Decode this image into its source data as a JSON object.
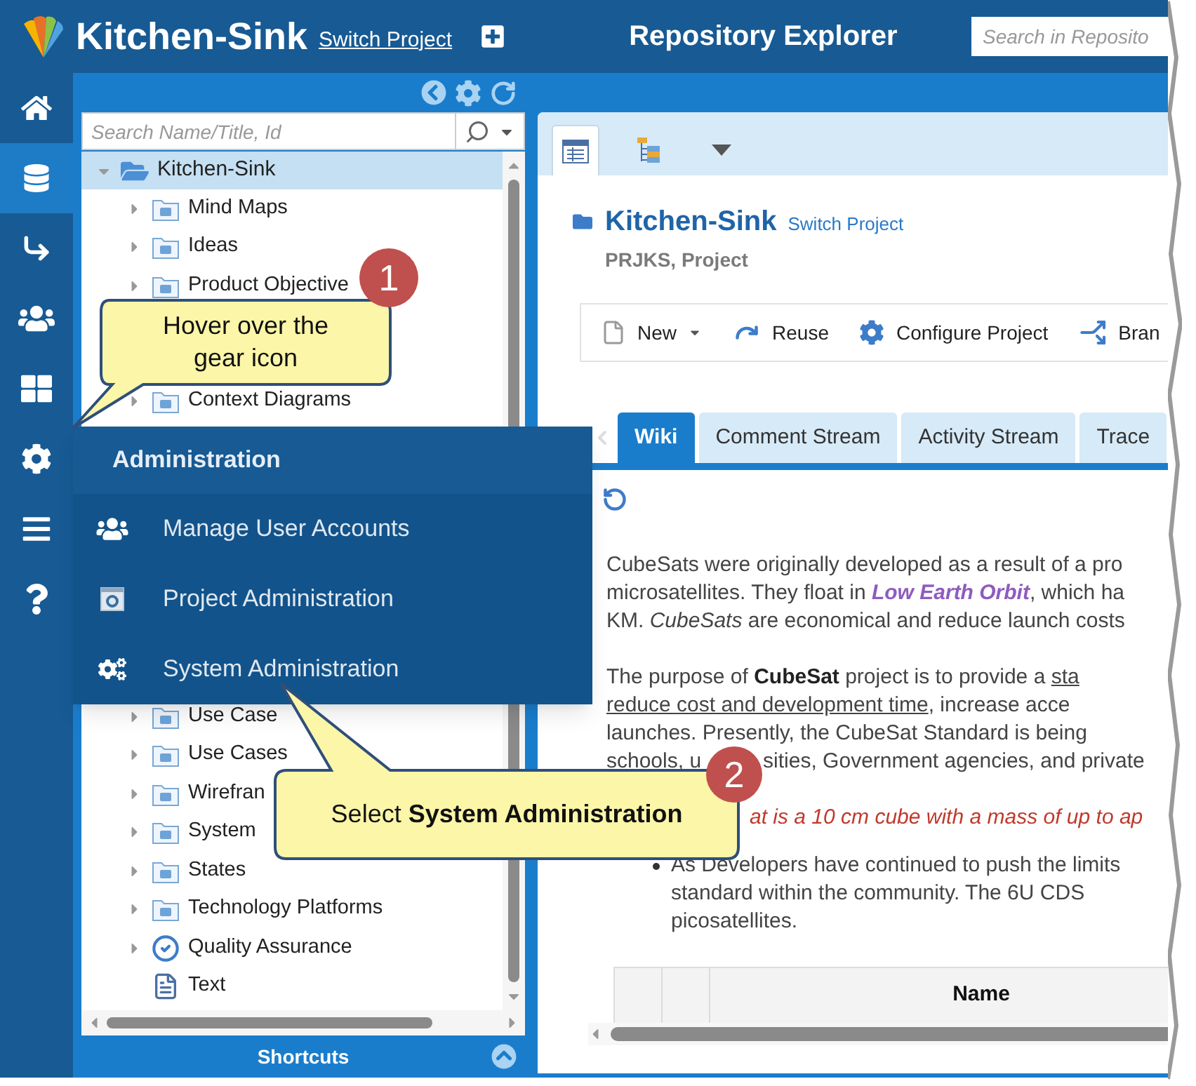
{
  "header": {
    "title": "Kitchen-Sink",
    "switch_link": "Switch Project",
    "page_title": "Repository Explorer",
    "search": {
      "placeholder": "Search in Reposito"
    }
  },
  "rail": [
    {
      "kind": "home",
      "selected": false
    },
    {
      "kind": "database",
      "selected": true
    },
    {
      "kind": "arrow",
      "selected": false
    },
    {
      "kind": "users",
      "selected": false
    },
    {
      "kind": "grid",
      "selected": false
    },
    {
      "kind": "settings",
      "selected": false
    },
    {
      "kind": "menu",
      "selected": false
    },
    {
      "kind": "help",
      "selected": false
    }
  ],
  "tree_panel": {
    "search": {
      "placeholder": "Search Name/Title, Id"
    },
    "tree": [
      {
        "label": "Kitchen-Sink",
        "expanded": true,
        "selected": true,
        "children": [
          {
            "label": "Mind Maps",
            "kind": "folder",
            "selected": false
          },
          {
            "label": "Ideas",
            "kind": "folder",
            "selected": false
          },
          {
            "label": "Product Objective",
            "kind": "folder",
            "selected": false
          },
          {
            "label": "Context Diagrams",
            "kind": "folder",
            "selected": false
          },
          {
            "label": "Use Case",
            "kind": "folder",
            "selected": false
          },
          {
            "label": "Use Cases",
            "kind": "folder",
            "selected": false
          },
          {
            "label": "Wirefran",
            "kind": "folder",
            "selected": false
          },
          {
            "label": "System",
            "kind": "folder",
            "selected": false
          },
          {
            "label": "States",
            "kind": "folder",
            "selected": false
          },
          {
            "label": "Technology Platforms",
            "kind": "folder",
            "selected": false
          },
          {
            "label": "Quality Assurance",
            "kind": "check",
            "selected": false
          },
          {
            "label": "Text",
            "kind": "document",
            "selected": false
          }
        ]
      }
    ],
    "footer": "Shortcuts"
  },
  "content": {
    "view_tabs": [
      {
        "kind": "grid",
        "selected": true
      },
      {
        "kind": "tree",
        "selected": false
      },
      {
        "kind": "menu",
        "selected": false
      }
    ],
    "project": {
      "title": "Kitchen-Sink",
      "link": "Switch Project",
      "subtitle": "PRJKS, Project"
    },
    "toolbar": [
      {
        "label": "New",
        "kind": "new"
      },
      {
        "label": "Reuse",
        "kind": "reuse"
      },
      {
        "label": "Configure Project",
        "kind": "configure"
      },
      {
        "label": "Bran",
        "kind": "branch"
      }
    ],
    "tabs": [
      {
        "label": "Wiki",
        "selected": true
      },
      {
        "label": "Comment Stream",
        "selected": false
      },
      {
        "label": "Activity Stream",
        "selected": false
      },
      {
        "label": "Trace",
        "selected": false
      }
    ],
    "wiki": {
      "paragraphs": [
        [
          [
            {
              "text": "CubeSats were originally developed as a result of a pro"
            }
          ],
          [
            {
              "text": "microsatellites. They float in "
            },
            {
              "text": "Low Earth Orbit",
              "kind": "link"
            },
            {
              "text": ", which ha"
            }
          ],
          [
            {
              "text": "KM. "
            },
            {
              "text": "CubeSats",
              "kind": "italic"
            },
            {
              "text": " are economical and reduce launch costs"
            }
          ]
        ],
        [
          [
            {
              "text": "The purpose of "
            },
            {
              "text": "CubeSat",
              "kind": "bold"
            },
            {
              "text": " project is to provide a "
            },
            {
              "text": "sta",
              "kind": "underline"
            }
          ],
          [
            {
              "text": "reduce cost and development time",
              "kind": "underline"
            },
            {
              "text": ", increase acce"
            }
          ],
          [
            {
              "text": "launches. Presently, the CubeSat Standard is being"
            }
          ],
          [
            {
              "text": "schools, u"
            },
            {
              "text": "sities, Government agencies, and private",
              "kind": "gap"
            }
          ]
        ]
      ],
      "highlight": "at is a 10 cm cube with a mass of up to ap",
      "bullet": [
        "As Developers have continued to push the limits",
        "standard within the community. The 6U CDS",
        "picosatellites."
      ],
      "table": {
        "columns": [
          {
            "label": "Name"
          }
        ]
      }
    }
  },
  "admin_menu": {
    "title": "Administration",
    "items": [
      {
        "label": "Manage User Accounts",
        "kind": "users"
      },
      {
        "label": "Project Administration",
        "kind": "project"
      },
      {
        "label": "System Administration",
        "kind": "system"
      }
    ]
  },
  "callouts": [
    {
      "number": "1",
      "text": "Hover over the gear icon"
    },
    {
      "number": "2",
      "text": "Select **System Administration**"
    }
  ]
}
